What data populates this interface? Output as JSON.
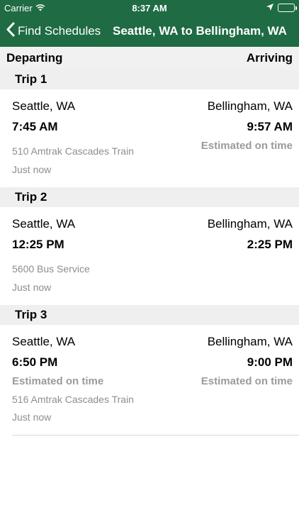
{
  "status_bar": {
    "carrier": "Carrier",
    "time": "8:37 AM",
    "icons": [
      "wifi-icon",
      "location-arrow-icon",
      "battery-icon"
    ]
  },
  "nav": {
    "back_label": "Find Schedules",
    "title": "Seattle, WA to Bellingham, WA",
    "bar_color": "#1f6b44"
  },
  "columns": {
    "departing": "Departing",
    "arriving": "Arriving"
  },
  "trips": [
    {
      "label": "Trip 1",
      "depart_city": "Seattle, WA",
      "depart_time": "7:45 AM",
      "depart_status": "",
      "arrive_city": "Bellingham, WA",
      "arrive_time": "9:57 AM",
      "arrive_status": "Estimated on time",
      "service": "510 Amtrak Cascades Train",
      "updated": "Just now"
    },
    {
      "label": "Trip 2",
      "depart_city": "Seattle, WA",
      "depart_time": "12:25 PM",
      "depart_status": "",
      "arrive_city": "Bellingham, WA",
      "arrive_time": "2:25 PM",
      "arrive_status": "",
      "service": "5600 Bus Service",
      "updated": "Just now"
    },
    {
      "label": "Trip 3",
      "depart_city": "Seattle, WA",
      "depart_time": "6:50 PM",
      "depart_status": "Estimated on time",
      "arrive_city": "Bellingham, WA",
      "arrive_time": "9:00 PM",
      "arrive_status": "Estimated on time",
      "service": "516 Amtrak Cascades Train",
      "updated": "Just now"
    }
  ]
}
